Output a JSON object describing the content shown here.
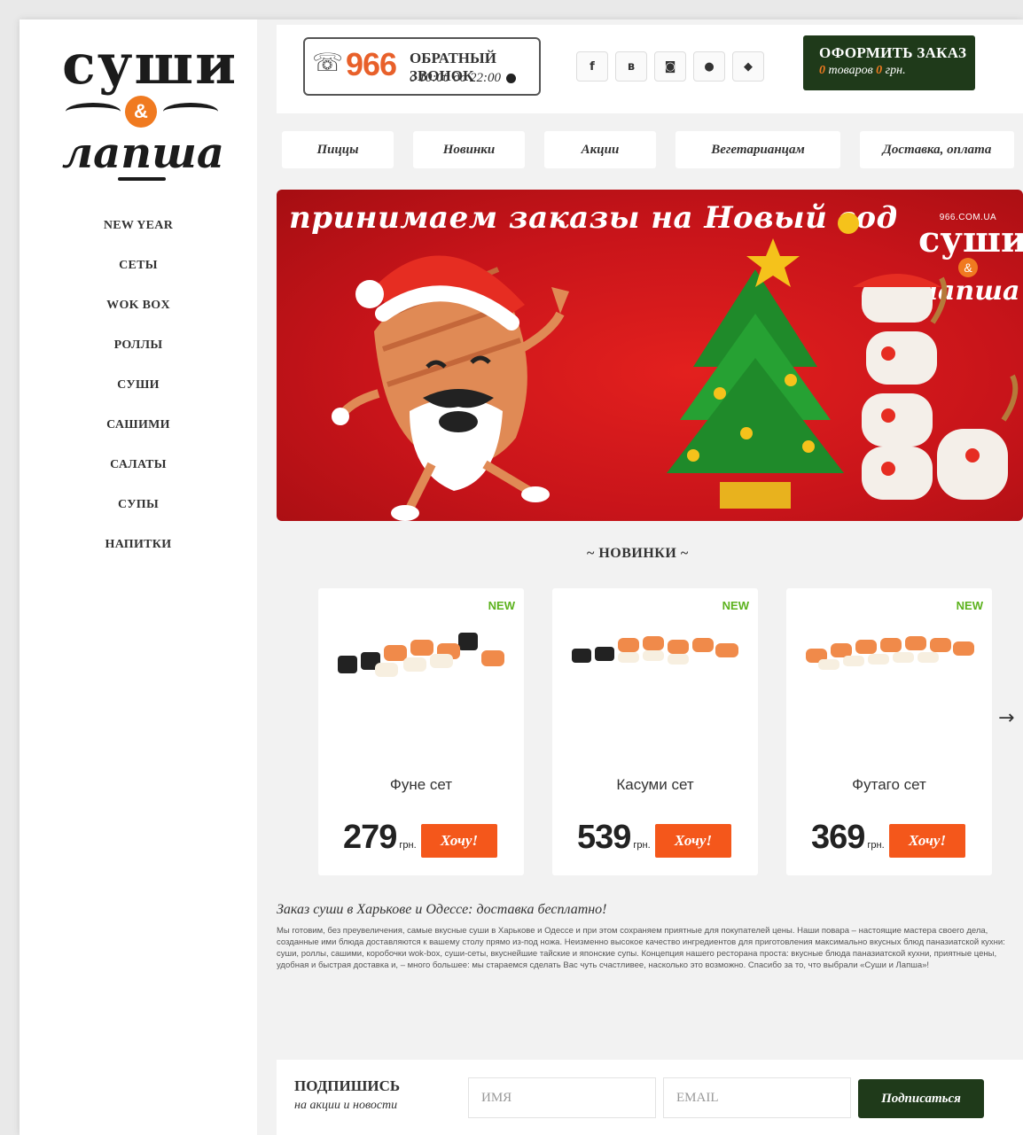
{
  "logo": {
    "top": "суши",
    "amp": "&",
    "bottom": "лапша"
  },
  "sidebar": {
    "items": [
      {
        "label": "NEW YEAR"
      },
      {
        "label": "СЕТЫ"
      },
      {
        "label": "WOK BOX"
      },
      {
        "label": "РОЛЛЫ"
      },
      {
        "label": "СУШИ"
      },
      {
        "label": "САШИМИ"
      },
      {
        "label": "САЛАТЫ"
      },
      {
        "label": "СУПЫ"
      },
      {
        "label": "НАПИТКИ"
      }
    ]
  },
  "header": {
    "callback": {
      "number": "966",
      "title": "ОБРАТНЫЙ ЗВОНОК",
      "hours": "с 10:00 до 22:00"
    },
    "socials": [
      {
        "label": "f",
        "icon": "facebook-icon"
      },
      {
        "label": "в",
        "icon": "vkontakte-icon"
      },
      {
        "label": "◙",
        "icon": "instagram-icon"
      },
      {
        "label": "●",
        "icon": "apple-icon"
      },
      {
        "label": "◆",
        "icon": "android-icon"
      }
    ],
    "order": {
      "title": "ОФОРМИТЬ ЗАКАЗ",
      "count": "0",
      "count_label": "товаров",
      "sum": "0",
      "sum_label": "грн."
    }
  },
  "nav": {
    "items": [
      {
        "label": "Пиццы"
      },
      {
        "label": "Новинки"
      },
      {
        "label": "Акции"
      },
      {
        "label": "Вегетарианцам"
      },
      {
        "label": "Доставка, оплата"
      }
    ]
  },
  "banner": {
    "title": "принимаем заказы на Новый год",
    "logo_url": "966.COM.UA",
    "logo_top": "суши",
    "logo_amp": "&",
    "logo_bottom": "лапша"
  },
  "section": {
    "title": "~ НОВИНКИ ~"
  },
  "products": [
    {
      "badge": "NEW",
      "name": "Фуне сет",
      "price": "279",
      "currency": "грн.",
      "button": "Хочу!"
    },
    {
      "badge": "NEW",
      "name": "Касуми сет",
      "price": "539",
      "currency": "грн.",
      "button": "Хочу!"
    },
    {
      "badge": "NEW",
      "name": "Футаго сет",
      "price": "369",
      "currency": "грн.",
      "button": "Хочу!"
    }
  ],
  "carousel": {
    "next": "→"
  },
  "about": {
    "title": "Заказ суши в Харькове и Одессе: доставка бесплатно!",
    "text": "Мы готовим, без преувеличения, самые вкусные суши в Харькове и Одессе и при этом сохраняем приятные для покупателей цены. Наши повара – настоящие мастера своего дела, созданные ими блюда доставляются к вашему столу прямо из-под ножа. Неизменно высокое качество ингредиентов для приготовления максимально вкусных блюд паназиатской кухни: суши, роллы, сашими, коробочки wok-box, суши-сеты, вкуснейшие тайские и японские супы. Концепция нашего ресторана проста: вкусные блюда паназиатской кухни, приятные цены, удобная и быстрая доставка и, – много большее: мы стараемся сделать Вас чуть счастливее, насколько это возможно. Спасибо за то, что выбрали «Суши и Лапша»!"
  },
  "subscribe": {
    "title": "ПОДПИШИСЬ",
    "subtitle": "на акции и новости",
    "name_placeholder": "ИМЯ",
    "email_placeholder": "EMAIL",
    "button": "Подписаться"
  },
  "colors": {
    "accent": "#f4571b",
    "dark_green": "#1f3a1a",
    "banner_red": "#c8141a",
    "new_badge": "#5cb21e"
  }
}
